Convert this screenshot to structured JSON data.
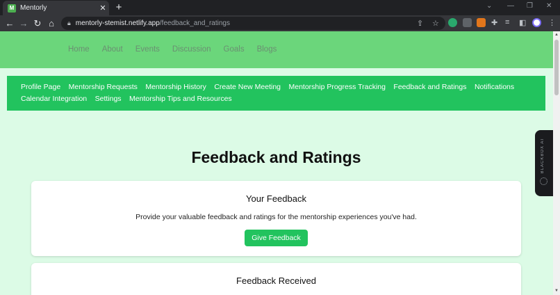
{
  "browser": {
    "tab_title": "Mentorly",
    "tab_close": "✕",
    "new_tab": "+",
    "url_host": "mentorly-stemist.netlify.app",
    "url_path": "/feedback_and_ratings"
  },
  "header": {
    "nav": [
      "Home",
      "About",
      "Events",
      "Discussion",
      "Goals",
      "Blogs"
    ]
  },
  "sub_nav": {
    "items": [
      "Profile Page",
      "Mentorship Requests",
      "Mentorship History",
      "Create New Meeting",
      "Mentorship Progress Tracking",
      "Feedback and Ratings",
      "Notifications",
      "Calendar Integration",
      "Settings",
      "Mentorship Tips and Resources"
    ]
  },
  "main": {
    "title": "Feedback and Ratings",
    "your_feedback": {
      "heading": "Your Feedback",
      "text": "Provide your valuable feedback and ratings for the mentorship experiences you've had.",
      "button": "Give Feedback"
    },
    "received": {
      "heading": "Feedback Received"
    }
  },
  "widget": {
    "label": "BLACKBOX AI"
  },
  "icons": {
    "back": "back-arrow-icon",
    "forward": "forward-arrow-icon",
    "reload": "reload-icon",
    "home": "home-icon",
    "lock": "lock-icon",
    "share": "share-icon",
    "star": "bookmark-star-icon",
    "extensions": "puzzle-icon",
    "menu": "kebab-menu-icon"
  },
  "colors": {
    "header_green": "#6bd67b",
    "nav_green": "#22c35e",
    "page_bg": "#dcfbe6"
  }
}
